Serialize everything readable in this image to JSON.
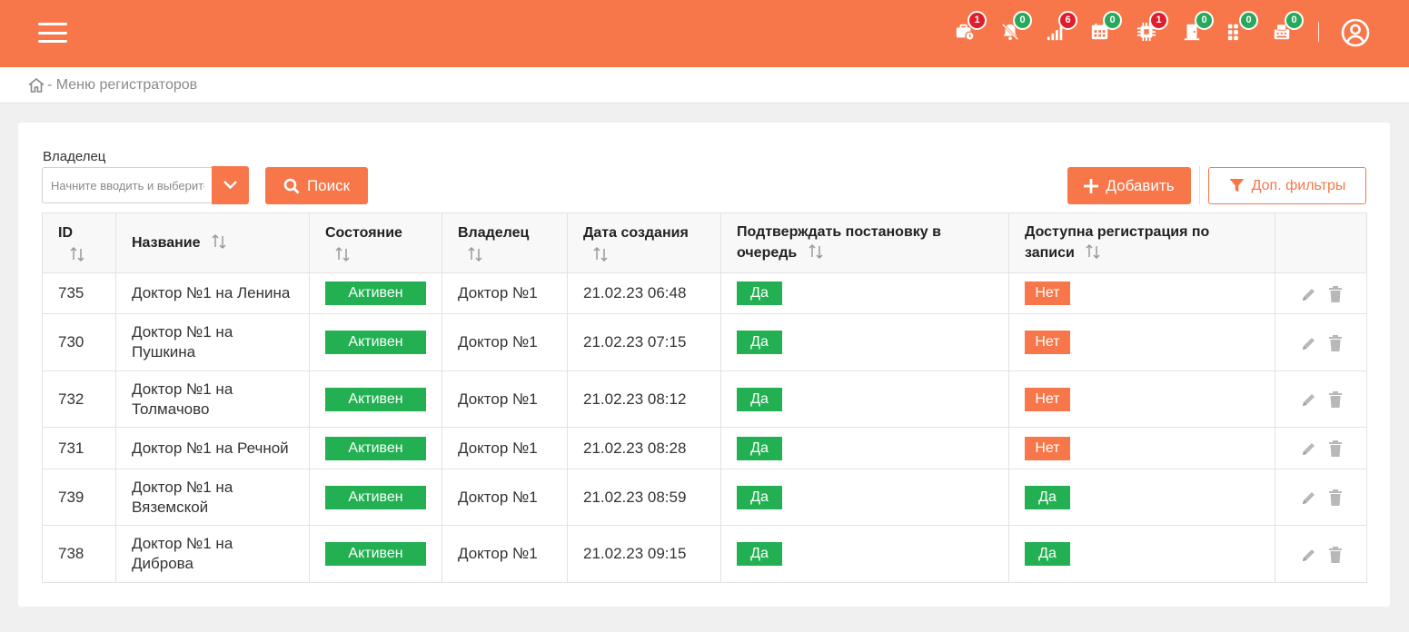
{
  "header": {
    "menu_icon": "hamburger-icon",
    "status_icons": [
      {
        "name": "briefcase-clock-icon",
        "badge": "1",
        "badge_color": "#e11d2b"
      },
      {
        "name": "bell-off-icon",
        "badge": "0",
        "badge_color": "#28a85a"
      },
      {
        "name": "signal-bars-icon",
        "badge": "6",
        "badge_color": "#e11d2b"
      },
      {
        "name": "calendar-icon",
        "badge": "0",
        "badge_color": "#28a85a"
      },
      {
        "name": "chip-icon",
        "badge": "1",
        "badge_color": "#e11d2b"
      },
      {
        "name": "door-icon",
        "badge": "0",
        "badge_color": "#28a85a"
      },
      {
        "name": "grid-dots-icon",
        "badge": "0",
        "badge_color": "#28a85a"
      },
      {
        "name": "printer-icon",
        "badge": "0",
        "badge_color": "#28a85a"
      }
    ],
    "user_icon": "user-circle-icon",
    "accent_color": "#f7774a"
  },
  "breadcrumb": {
    "home_icon": "home-icon",
    "text": "- Меню регистраторов"
  },
  "filters": {
    "owner_label": "Владелец",
    "owner_placeholder": "Начните вводить и выберите",
    "search_label": "Поиск",
    "add_label": "Добавить",
    "more_filters_label": "Доп. фильтры"
  },
  "table": {
    "columns": {
      "id": "ID",
      "name": "Название",
      "state": "Состояние",
      "owner": "Владелец",
      "created": "Дата создания",
      "confirm": "Подтверждать постановку в очередь",
      "booking": "Доступна регистрация по записи"
    },
    "rows": [
      {
        "id": "735",
        "name": "Доктор №1 на Ленина",
        "state": "Активен",
        "owner": "Доктор №1",
        "created": "21.02.23 06:48",
        "confirm": "Да",
        "booking": "Нет"
      },
      {
        "id": "730",
        "name": "Доктор №1 на Пушкина",
        "state": "Активен",
        "owner": "Доктор №1",
        "created": "21.02.23 07:15",
        "confirm": "Да",
        "booking": "Нет"
      },
      {
        "id": "732",
        "name": "Доктор №1 на Толмачово",
        "state": "Активен",
        "owner": "Доктор №1",
        "created": "21.02.23 08:12",
        "confirm": "Да",
        "booking": "Нет"
      },
      {
        "id": "731",
        "name": "Доктор №1 на Речной",
        "state": "Активен",
        "owner": "Доктор №1",
        "created": "21.02.23 08:28",
        "confirm": "Да",
        "booking": "Нет"
      },
      {
        "id": "739",
        "name": "Доктор №1 на Вяземской",
        "state": "Активен",
        "owner": "Доктор №1",
        "created": "21.02.23 08:59",
        "confirm": "Да",
        "booking": "Да"
      },
      {
        "id": "738",
        "name": "Доктор №1 на Диброва",
        "state": "Активен",
        "owner": "Доктор №1",
        "created": "21.02.23 09:15",
        "confirm": "Да",
        "booking": "Да"
      }
    ],
    "status_colors": {
      "positive": "#22b052",
      "negative": "#f7774a"
    }
  }
}
